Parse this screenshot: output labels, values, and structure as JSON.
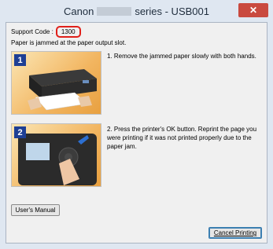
{
  "window": {
    "title_left": "Canon",
    "title_right": "series - USB001",
    "close_label": "✕"
  },
  "dialog": {
    "support_code_label": "Support Code :",
    "support_code": "1300",
    "message": "Paper is jammed at the paper output slot.",
    "steps": [
      {
        "number": "1",
        "text": "1.  Remove the jammed paper slowly with both hands."
      },
      {
        "number": "2",
        "text": "2.  Press the printer's OK button. Reprint the page you were printing if it was not printed properly due to the paper jam."
      }
    ],
    "manual_button": "User's Manual",
    "cancel_button": "Cancel Printing"
  }
}
